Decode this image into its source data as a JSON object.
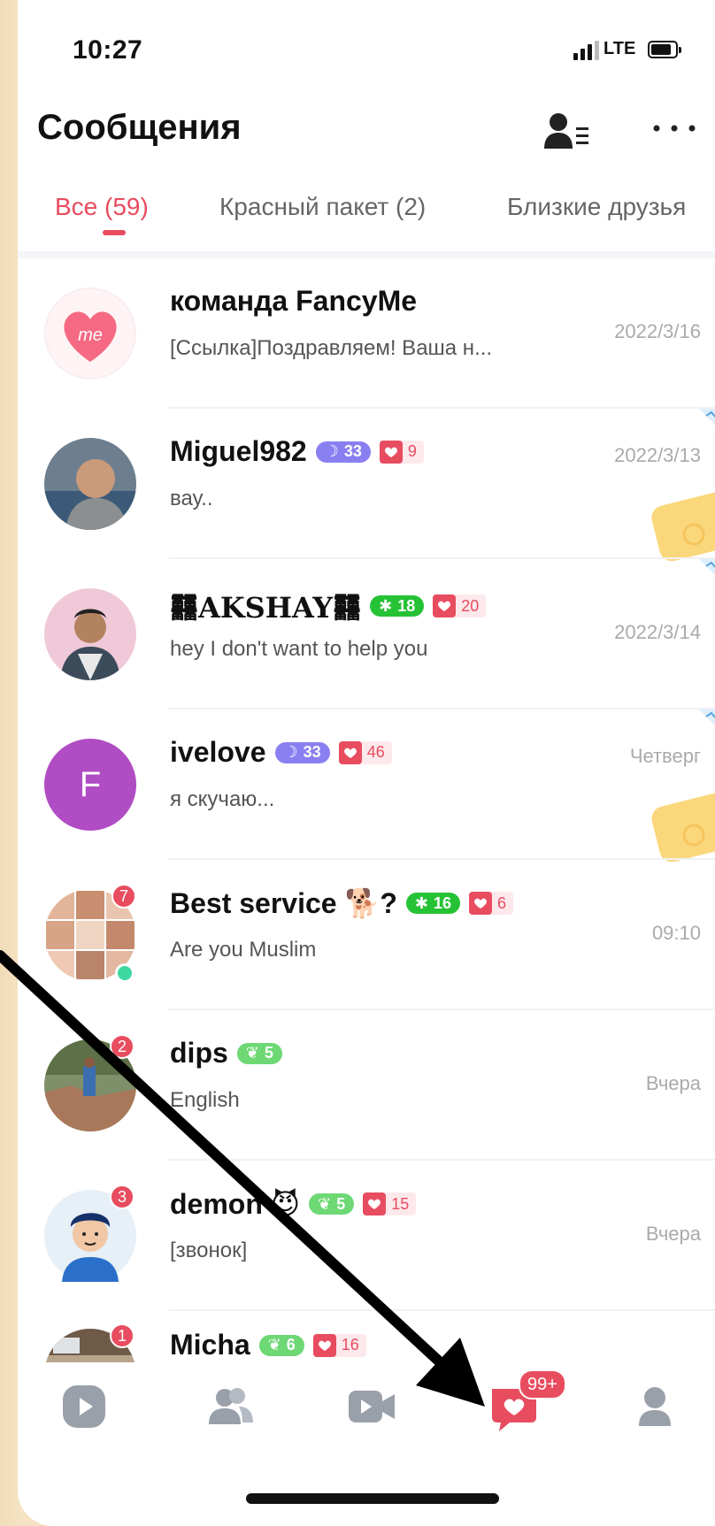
{
  "status_bar": {
    "time": "10:27",
    "network": "LTE"
  },
  "header": {
    "title": "Сообщения"
  },
  "tabs": [
    {
      "label": "Все (59)"
    },
    {
      "label": "Красный пакет (2)"
    },
    {
      "label": "Близкие друзья"
    }
  ],
  "conversations": [
    {
      "name": "команда FancyMe",
      "preview": "[Ссылка]Поздравляем! Ваша н...",
      "date": "2022/3/16"
    },
    {
      "name": "Miguel982",
      "badge_level": "33",
      "badge_hearts": "9",
      "preview": "вау..",
      "date": "2022/3/13"
    },
    {
      "name": "AKSHAY",
      "badge_level": "18",
      "badge_hearts": "20",
      "preview": "hey I don't want to help you",
      "date": "2022/3/14"
    },
    {
      "name": "ivelove",
      "badge_level": "33",
      "badge_hearts": "46",
      "preview": "я скучаю...",
      "date": "Четверг",
      "avatar_letter": "F"
    },
    {
      "name": "Best service 🐕?",
      "badge_level": "16",
      "badge_hearts": "6",
      "preview": "Are you Muslim",
      "date": "09:10",
      "unread": "7"
    },
    {
      "name": "dips",
      "badge_level": "5",
      "preview": "English",
      "date": "Вчера",
      "unread": "2"
    },
    {
      "name": "demon 😈",
      "badge_level": "5",
      "badge_hearts": "15",
      "preview": "[звонок]",
      "date": "Вчера",
      "unread": "3"
    },
    {
      "name": "Micha",
      "badge_level": "6",
      "badge_hearts": "16",
      "unread": "1"
    }
  ],
  "tabbar": {
    "messages_badge": "99+"
  },
  "colors": {
    "accent": "#e84c5f",
    "moon_badge": "#8a7ff0",
    "green_badge": "#26c236",
    "light_green_badge": "#6dd874"
  }
}
